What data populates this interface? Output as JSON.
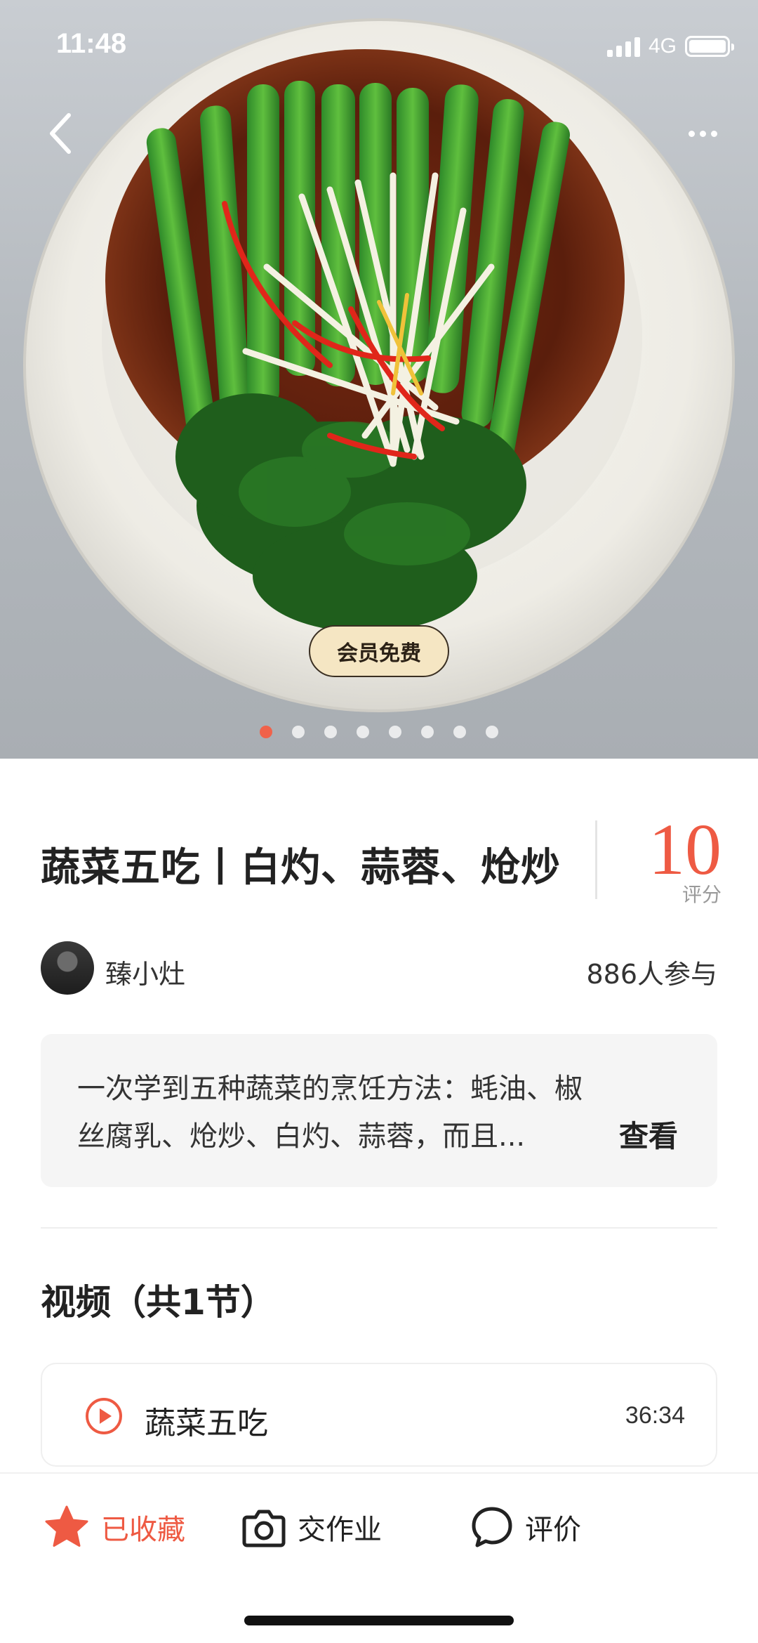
{
  "status_bar": {
    "time": "11:48",
    "network": "4G"
  },
  "hero": {
    "badge": "会员免费",
    "image_count": 8,
    "active_image": 1
  },
  "recipe": {
    "title": "蔬菜五吃丨白灼、蒜蓉、炝炒",
    "rating_value": "10",
    "rating_label": "评分",
    "author": "臻小灶",
    "participants": "886人参与",
    "description_lines": [
      "一次学到五种蔬菜的烹饪方法：蚝油、椒",
      "丝腐乳、炝炒、白灼、蒜蓉，而且..."
    ],
    "more_label": "查看"
  },
  "videos": {
    "title": "视频（共1节）",
    "items": [
      {
        "name": "蔬菜五吃",
        "duration": "36:34"
      }
    ]
  },
  "bottom_bar": {
    "collect_label": "已收藏",
    "homework_label": "交作业",
    "review_label": "评价"
  },
  "colors": {
    "accent": "#ee5a43",
    "badge_bg": "#f5e6c3",
    "description_bg": "#f5f5f5"
  },
  "icons": [
    "back-icon",
    "more-icon",
    "play-icon",
    "star-icon",
    "camera-icon",
    "comment-icon"
  ]
}
